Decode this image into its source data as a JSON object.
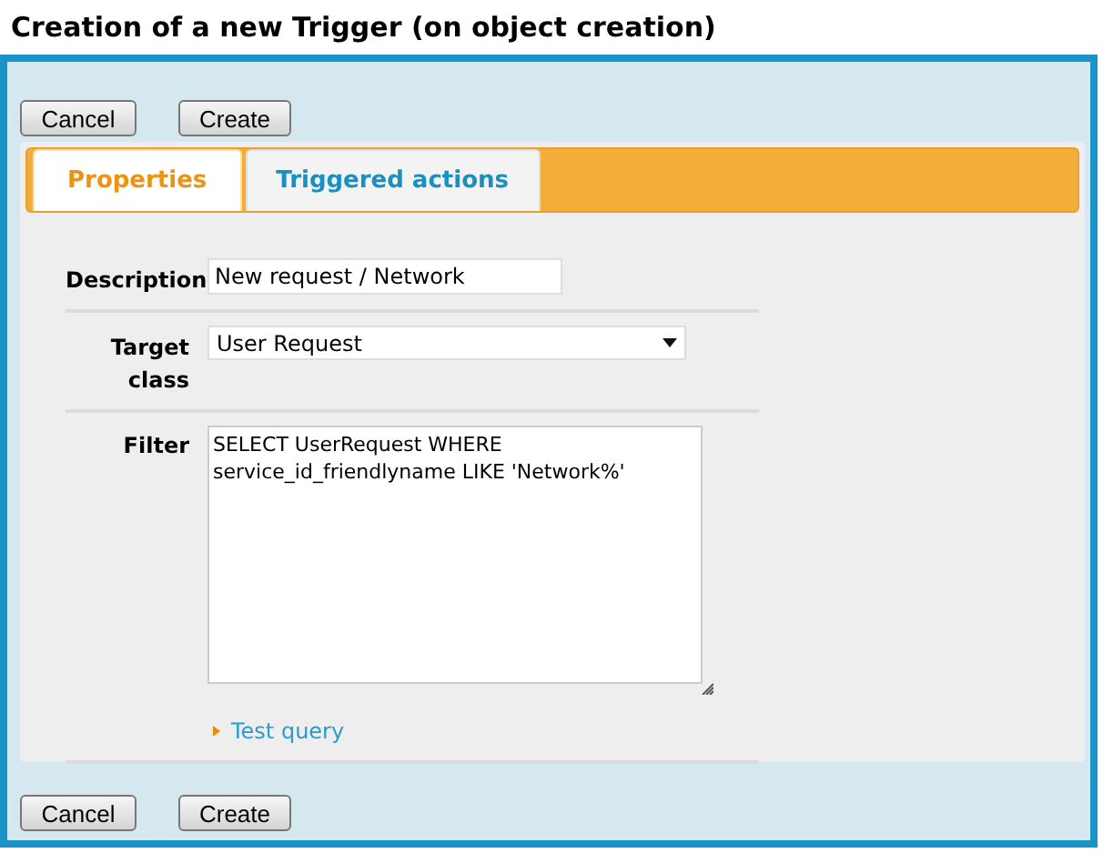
{
  "window": {
    "title": "Creation of a new Trigger (on object creation)"
  },
  "top_buttons": [
    "Cancel",
    "Create"
  ],
  "tabs": [
    {
      "label": "Properties",
      "selected": true
    },
    {
      "label": "Triggered actions",
      "selected": false
    }
  ],
  "fields": [
    {
      "kind": "text",
      "label": "Description",
      "value": "New request / Network"
    },
    {
      "kind": "select",
      "label": "Target class",
      "value": "User Request"
    },
    {
      "kind": "textarea",
      "label": "Filter",
      "value": "SELECT UserRequest WHERE\nservice_id_friendlyname LIKE 'Network%'",
      "link": "Test query"
    }
  ],
  "bottom_buttons": [
    "Cancel",
    "Create"
  ]
}
